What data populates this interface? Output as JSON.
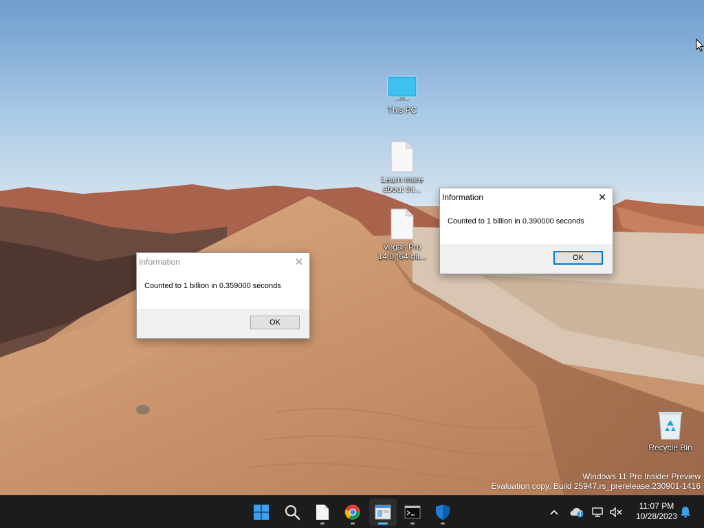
{
  "desktop": {
    "icons": [
      {
        "label": "This PC",
        "icon": "monitor-icon"
      },
      {
        "label_line1": "Learn more",
        "label_line2": "about thi...",
        "icon": "document-icon"
      },
      {
        "label_line1": "Vegas Pro",
        "label_line2": "14.0 (64-bit...",
        "icon": "document-icon"
      },
      {
        "label": "Recycle Bin",
        "icon": "recycle-bin-icon"
      }
    ],
    "watermark": {
      "line1": "Windows 11 Pro Insider Preview",
      "line2": "Evaluation copy. Build 25947.rs_prerelease.230901-1416"
    }
  },
  "dialogs": [
    {
      "title": "Information",
      "message": "Counted to 1 billion in 0.359000 seconds",
      "ok_label": "OK",
      "close_glyph": "✕",
      "state": "inactive"
    },
    {
      "title": "Information",
      "message": "Counted to 1 billion in 0.390000 seconds",
      "ok_label": "OK",
      "close_glyph": "✕",
      "state": "active"
    }
  ],
  "taskbar": {
    "apps": [
      {
        "name": "start-button",
        "icon": "windows-logo-icon"
      },
      {
        "name": "search-button",
        "icon": "search-icon"
      },
      {
        "name": "notepad-app",
        "icon": "document-icon",
        "running": true
      },
      {
        "name": "chrome-app",
        "icon": "chrome-icon",
        "running": true
      },
      {
        "name": "explorer-app",
        "icon": "window-app-icon",
        "running": true,
        "active": true
      },
      {
        "name": "terminal-app",
        "icon": "terminal-icon",
        "running": true
      },
      {
        "name": "defender-app",
        "icon": "shield-icon",
        "running": true
      }
    ],
    "tray": {
      "chevron": "^",
      "time": "11:07 PM",
      "date": "10/28/2023"
    }
  },
  "colors": {
    "accent": "#0078d7",
    "taskbar_bg": "#1c1c1c",
    "active_indicator": "#4cc2ff"
  }
}
